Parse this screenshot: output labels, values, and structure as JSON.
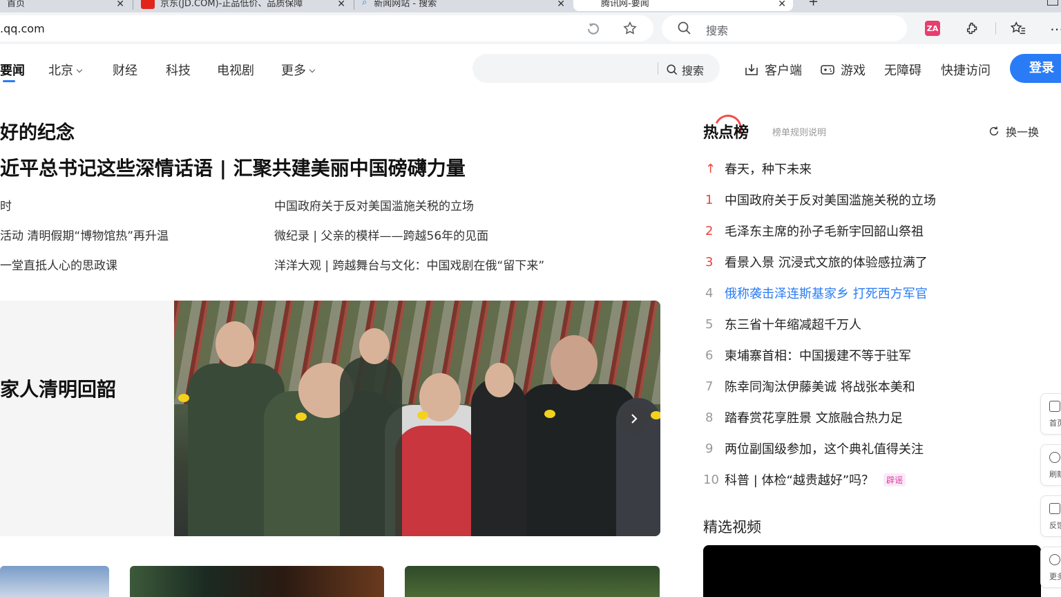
{
  "browser": {
    "tabs": [
      {
        "label": "首页",
        "active": false
      },
      {
        "label": "京东(JD.COM)-正品低价、品质保障",
        "active": false
      },
      {
        "label": "新闻网站 - 搜索",
        "active": false
      },
      {
        "label": "腾讯网-要闻",
        "active": true
      }
    ],
    "url": ".qq.com",
    "search_placeholder": "搜索",
    "translate_label": "ZA"
  },
  "site_nav": {
    "items": [
      {
        "label": "要闻",
        "active": true
      },
      {
        "label": "北京",
        "dropdown": true
      },
      {
        "label": "财经"
      },
      {
        "label": "科技"
      },
      {
        "label": "电视剧"
      },
      {
        "label": "更多",
        "dropdown": true
      }
    ],
    "search_button": "搜索",
    "search_value": "",
    "links": [
      "客户端",
      "游戏",
      "无障碍",
      "快捷访问"
    ],
    "login": "登录"
  },
  "main": {
    "headline_small": "好的纪念",
    "headline_big": "近平总书记这些深情话语 | 汇聚共建美丽中国磅礴力量",
    "links_left": [
      "时",
      "活动 清明假期“博物馆热”再升温",
      "一堂直抵人心的思政课"
    ],
    "links_right": [
      "中国政府关于反对美国滥施关税的立场",
      "微纪录 | 父亲的模样——跨越56年的见面",
      "洋洋大观 | 跨越舞台与文化：中国戏剧在俄“留下来”"
    ],
    "feature_title": "家人清明回韶"
  },
  "hot": {
    "title": "热点榜",
    "rule": "榜单规则说明",
    "refresh": "换一换",
    "pinned_icon": "↑",
    "items": [
      {
        "rank": "",
        "text": "春天，种下未来",
        "pinned": true
      },
      {
        "rank": "1",
        "text": "中国政府关于反对美国滥施关税的立场",
        "top": true
      },
      {
        "rank": "2",
        "text": "毛泽东主席的孙子毛新宇回韶山祭祖",
        "top": true
      },
      {
        "rank": "3",
        "text": "看景入景 沉浸式文旅的体验感拉满了",
        "top": true
      },
      {
        "rank": "4",
        "text": "俄称袭击泽连斯基家乡 打死西方军官",
        "highlight": true
      },
      {
        "rank": "5",
        "text": "东三省十年缩减超千万人"
      },
      {
        "rank": "6",
        "text": "柬埔寨首相：中国援建不等于驻军"
      },
      {
        "rank": "7",
        "text": "陈幸同淘汰伊藤美诚 将战张本美和"
      },
      {
        "rank": "8",
        "text": "踏春赏花享胜景 文旅融合热力足"
      },
      {
        "rank": "9",
        "text": "两位副国级参加，这个典礼值得关注"
      },
      {
        "rank": "10",
        "text": "科普 | 体检“越贵越好”吗？",
        "tag": "辟谣"
      }
    ],
    "video_title": "精选视频"
  },
  "side_tools": [
    "首页",
    "刷新",
    "反馈",
    "更多"
  ],
  "colors": {
    "accent": "#2a7cf6",
    "hot_red": "#f0413c",
    "rumor": "#d940a8"
  }
}
